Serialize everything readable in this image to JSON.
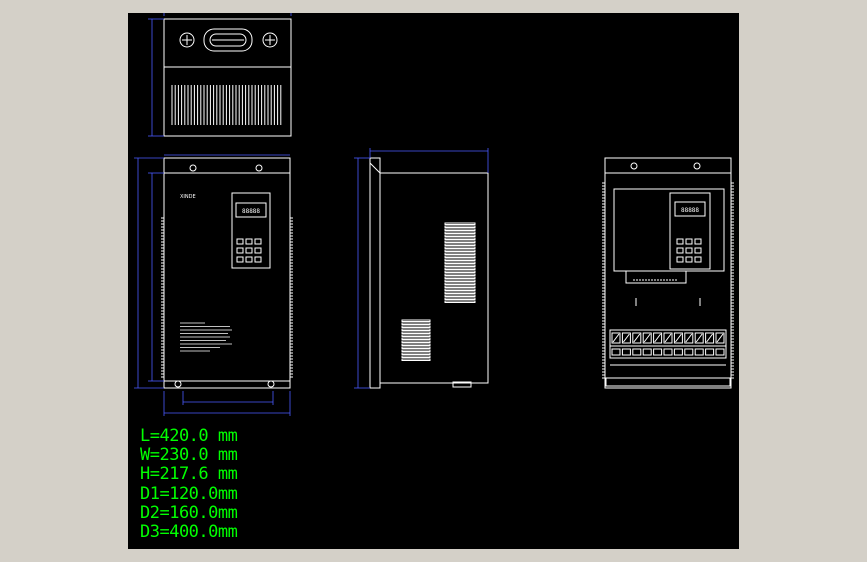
{
  "drawing": {
    "background": "#000000",
    "window_color": "#d4d0c8",
    "line_color": "#ffffff",
    "dimension_color": "#4a5aff",
    "text_color": "#00ff00",
    "brand_label": "XINDE",
    "keypad_display": "88888",
    "dimensions": [
      {
        "label": "L=420.0 mm"
      },
      {
        "label": "W=230.0 mm"
      },
      {
        "label": "H=217.6 mm"
      },
      {
        "label": "D1=120.0mm"
      },
      {
        "label": "D2=160.0mm"
      },
      {
        "label": "D3=400.0mm"
      }
    ]
  }
}
